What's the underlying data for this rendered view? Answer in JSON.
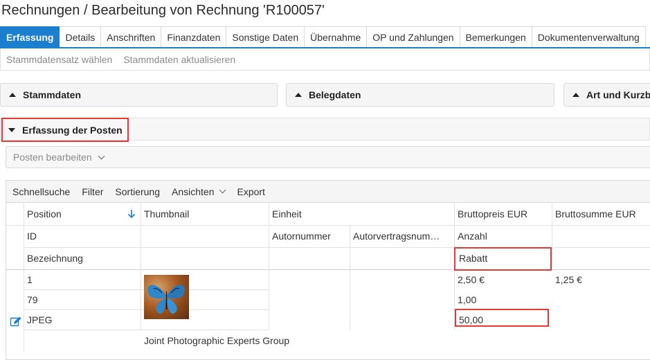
{
  "page": {
    "title": "Rechnungen / Bearbeitung von Rechnung 'R100057'"
  },
  "tabs": [
    "Erfassung",
    "Details",
    "Anschriften",
    "Finanzdaten",
    "Sonstige Daten",
    "Übernahme",
    "OP und Zahlungen",
    "Bemerkungen",
    "Dokumentenverwaltung"
  ],
  "active_tab": "Erfassung",
  "subbar": {
    "select_master": "Stammdatensatz wählen",
    "update_master": "Stammdaten aktualisieren"
  },
  "panels": {
    "stammdaten": "Stammdaten",
    "belegdaten": "Belegdaten",
    "art": "Art und Kurzbe"
  },
  "section": {
    "title": "Erfassung der Posten"
  },
  "posten_dropdown": "Posten bearbeiten",
  "toolbar": {
    "quicksearch": "Schnellsuche",
    "filter": "Filter",
    "sort": "Sortierung",
    "views": "Ansichten",
    "export": "Export"
  },
  "columns": {
    "position": "Position",
    "thumbnail": "Thumbnail",
    "einheit": "Einheit",
    "bruttopreis": "Bruttopreis EUR",
    "bruttosumme": "Bruttosumme EUR",
    "id": "ID",
    "autornummer": "Autornummer",
    "autorvertragsnummer": "Autorvertragsnum…",
    "anzahl": "Anzahl",
    "bezeichnung": "Bezeichnung",
    "rabatt": "Rabatt"
  },
  "row": {
    "position": "1",
    "id": "79",
    "bezeichnung": "JPEG",
    "bruttopreis": "2,50 €",
    "bruttosumme": "1,25 €",
    "anzahl": "1,00",
    "rabatt": "50,00",
    "description": "Joint Photographic Experts Group"
  },
  "colors": {
    "accent": "#1a7fcf",
    "highlight": "#e53935"
  },
  "icons": {
    "sort": "arrow-down-icon",
    "edit": "edit-pencil-icon",
    "collapse": "triangle-icon",
    "dropdown": "chevron-down-icon"
  }
}
